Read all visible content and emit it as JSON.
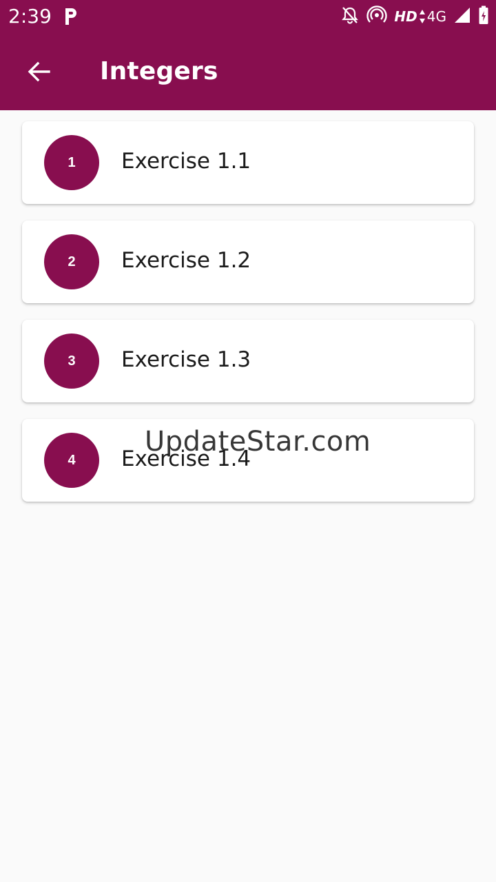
{
  "status_bar": {
    "time": "2:39",
    "network_type": "HD",
    "signal_label": "4G",
    "icons": [
      "parking-icon",
      "notifications-off-icon",
      "hotspot-icon",
      "signal-icon",
      "battery-icon"
    ]
  },
  "app_bar": {
    "title": "Integers",
    "back_icon": "arrow-back-icon"
  },
  "exercises": [
    {
      "number": "1",
      "label": "Exercise 1.1"
    },
    {
      "number": "2",
      "label": "Exercise 1.2"
    },
    {
      "number": "3",
      "label": "Exercise 1.3"
    },
    {
      "number": "4",
      "label": "Exercise 1.4"
    }
  ],
  "watermark": "UpdateStar.com",
  "colors": {
    "primary": "#880e4f",
    "background": "#fafafa",
    "card": "#ffffff",
    "text": "#1a1a1a"
  }
}
